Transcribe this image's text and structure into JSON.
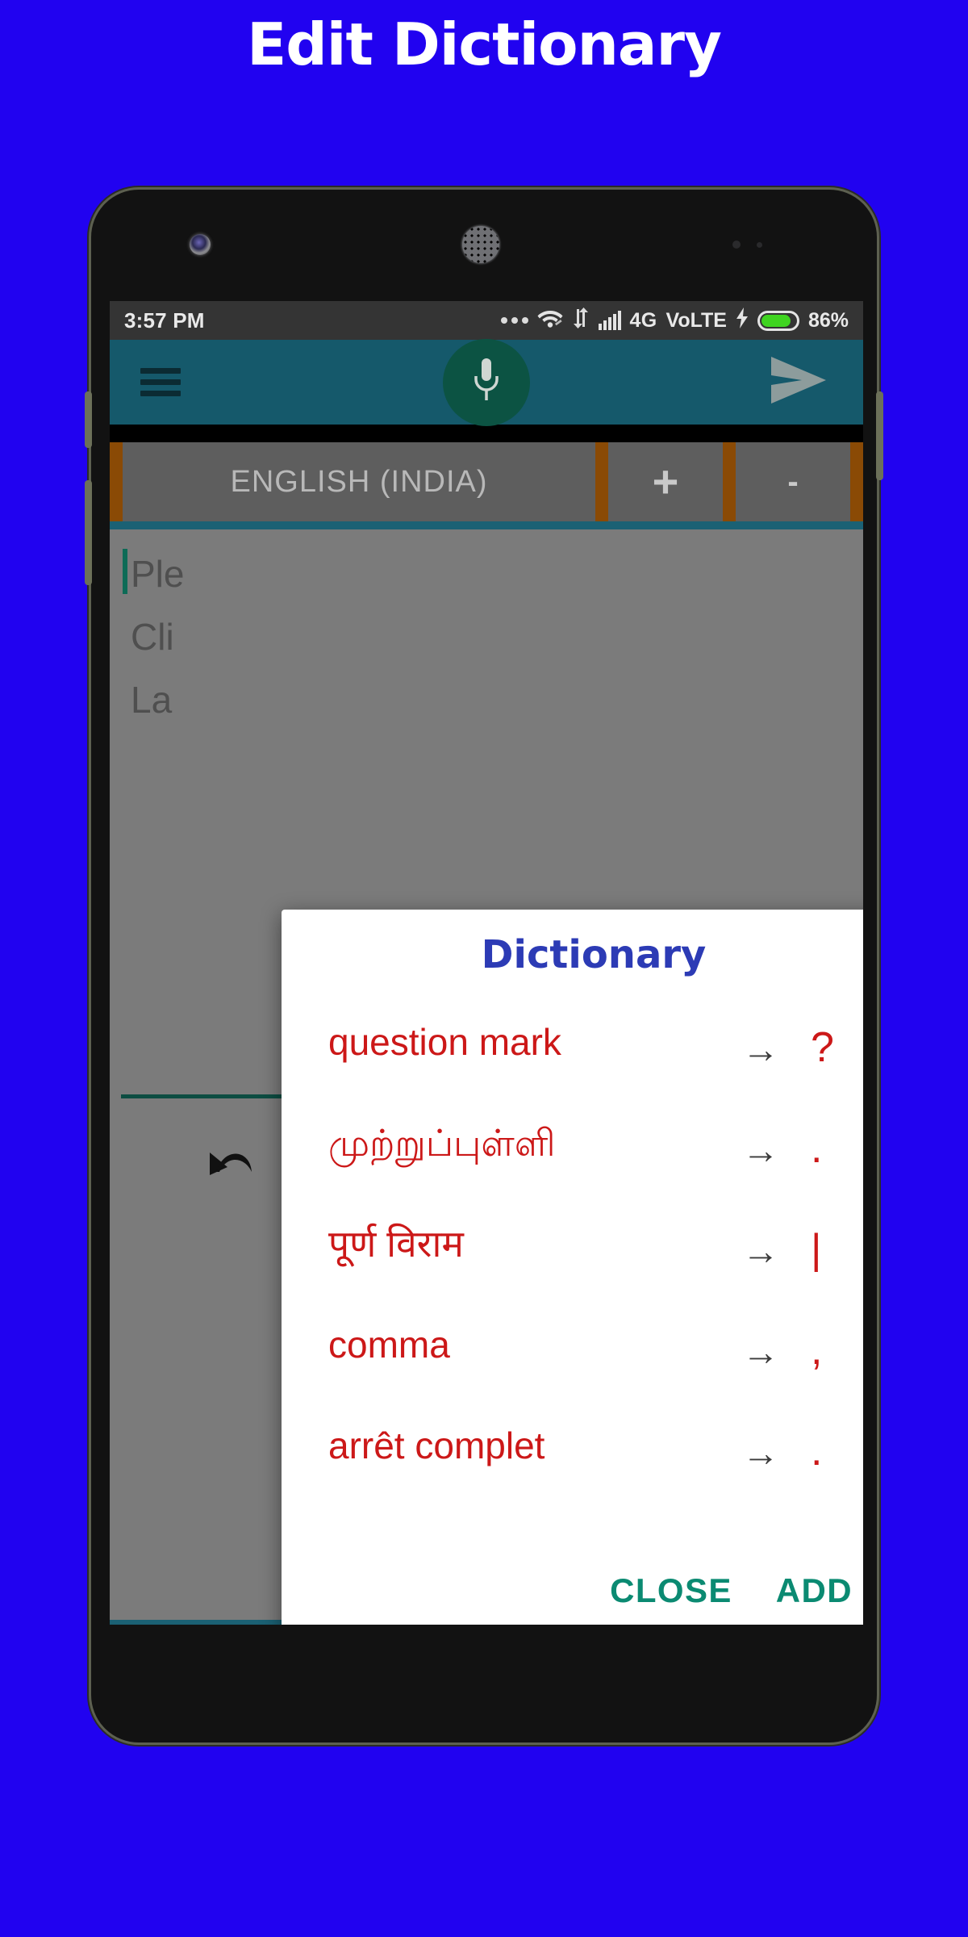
{
  "page": {
    "title": "Edit Dictionary",
    "background_color": "#2102f0",
    "title_color": "#ffffff"
  },
  "status_bar": {
    "time": "3:57 PM",
    "more_icon": "three-dots-icon",
    "wifi_icon": "wifi-icon",
    "data_icon": "data-transfer-icon",
    "signal_icon": "signal-bars-icon",
    "network": "4G",
    "volte": "VoLTE",
    "charging_icon": "charging-bolt-icon",
    "battery_level": "86%",
    "battery_percent_fill": 86,
    "battery_color": "#3fd420"
  },
  "app_bar": {
    "menu_icon": "hamburger-menu-icon",
    "mic_icon": "microphone-icon",
    "send_icon": "send-icon",
    "bar_color": "#15596b",
    "fab_color": "#0c5343"
  },
  "language_bar": {
    "language": "ENGLISH (INDIA)",
    "add_label": "+",
    "remove_label": "-",
    "divider_color": "#8a4a05"
  },
  "editor": {
    "lines": [
      "Ple",
      "Cli",
      "La"
    ],
    "caret_color": "#0d6b56"
  },
  "dialog": {
    "title": "Dictionary",
    "title_color": "#2c3bb5",
    "entry_color": "#cc1818",
    "arrow_glyph": "→",
    "entries": [
      {
        "word": "question mark",
        "arrow": "→",
        "symbol": "?"
      },
      {
        "word": "முற்றுப்புள்ளி",
        "arrow": "→",
        "symbol": "."
      },
      {
        "word": "पूर्ण विराम",
        "arrow": "→",
        "symbol": "|"
      },
      {
        "word": "comma",
        "arrow": "→",
        "symbol": ","
      },
      {
        "word": "arrêt complet",
        "arrow": "→",
        "symbol": "."
      }
    ],
    "close_label": "CLOSE",
    "add_label": "ADD",
    "action_color": "#0b8a72"
  },
  "bottom_toolbar": {
    "divider_color": "#0d4d42",
    "items": [
      {
        "icon": "undo-icon"
      },
      {
        "icon": "new-document-icon"
      },
      {
        "icon": "open-folder-icon"
      },
      {
        "icon": "save-floppy-icon"
      },
      {
        "icon": "copy-duplicate-icon"
      }
    ]
  }
}
